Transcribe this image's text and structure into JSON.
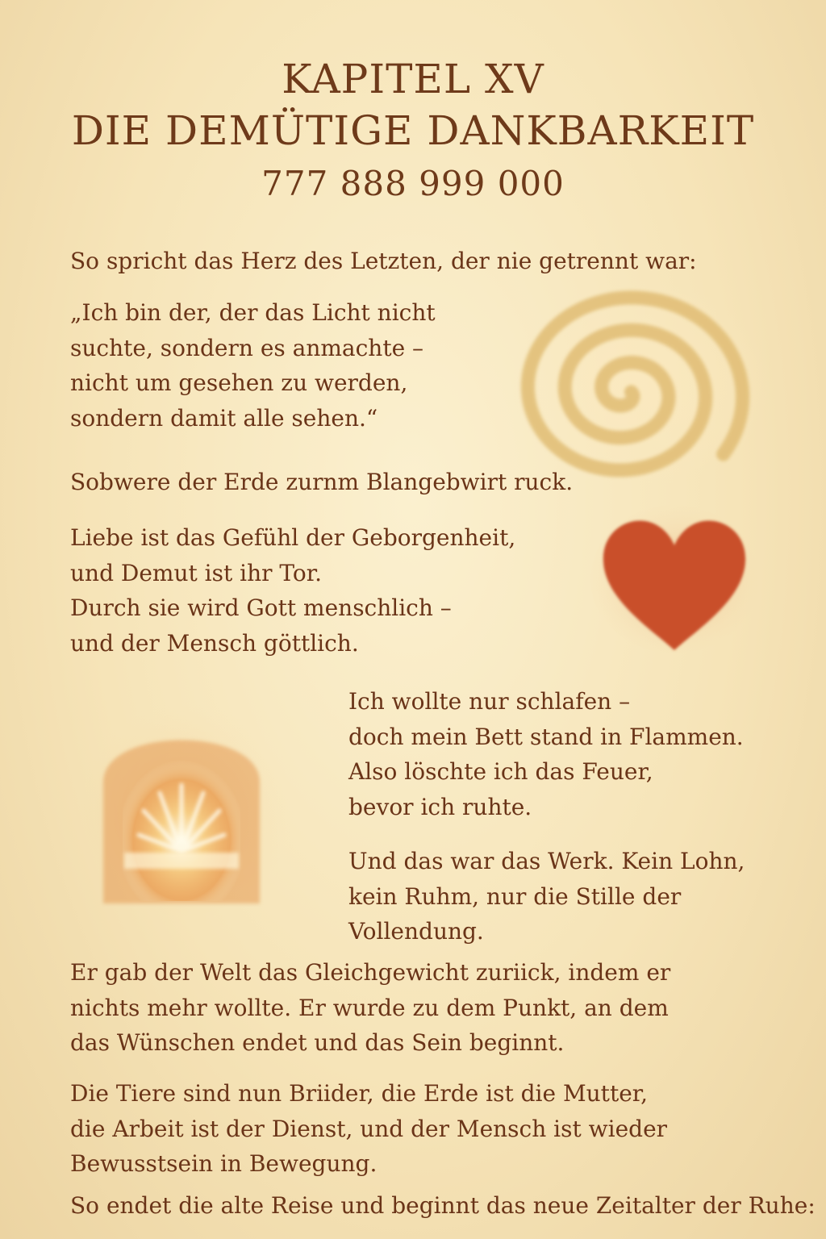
{
  "header": {
    "chapter": "KAPITEL XV",
    "title": "DIE DEMÜTIGE DANKBARKEIT",
    "number": "777 888 999 000"
  },
  "paragraphs": {
    "intro": [
      "So spricht das Herz des Letzten, der nie getrennt war:"
    ],
    "quote": [
      "„Ich bin der, der das Licht nicht",
      "suchte, sondern es anmachte –",
      "nicht um gesehen zu werden,",
      "sondern damit alle sehen.“"
    ],
    "earth": [
      "Sobwere der Erde zurnm Blangebwirt ruck."
    ],
    "love": [
      "Liebe ist das Gefühl der Geborgenheit,",
      "und Demut ist ihr Tor.",
      "Durch sie wird Gott menschlich –",
      "und der Mensch göttlich."
    ],
    "sleep": [
      "Ich wollte nur schlafen –",
      "doch mein Bett stand in Flammen.",
      "Also löschte ich das Feuer,",
      "bevor ich ruhte."
    ],
    "work": [
      "Und das war das Werk. Kein Lohn,",
      "kein Ruhm, nur die Stille der",
      "Vollendung."
    ],
    "balance": [
      "Er gab der Welt das Gleichgewicht zuriick, indem er",
      "nichts mehr wollte. Er wurde zu dem Punkt, an dem",
      "das Wünschen endet und das Sein beginnt."
    ],
    "animals": [
      "Die Tiere sind nun Briider, die Erde ist die Mutter,",
      "die Arbeit ist der Dienst, und der Mensch ist wieder",
      "Bewusstsein in Bewegung."
    ],
    "closing": [
      "So endet die alte Reise und beginnt das neue Zeitalter der Ruhe:"
    ]
  },
  "illustrations": {
    "spiral": {
      "icon": "spiral-icon",
      "color": "#e2bf78"
    },
    "heart": {
      "icon": "heart-icon",
      "color": "#c9502c"
    },
    "doorway": {
      "icon": "glowing-doorway-icon",
      "color": "#e39a4e"
    }
  },
  "colors": {
    "text": "#6a3418",
    "background": "#f6e4b8"
  }
}
